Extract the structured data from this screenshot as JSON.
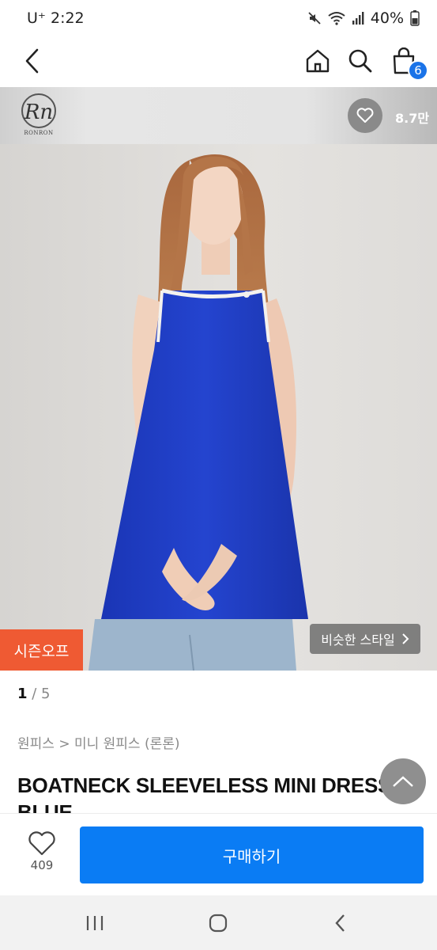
{
  "status_bar": {
    "carrier": "U⁺ 2:22",
    "battery": "40%",
    "icons": [
      "mute-icon",
      "wifi-icon",
      "signal-icon",
      "battery-icon"
    ]
  },
  "nav": {
    "icons": [
      "back-icon",
      "home-icon",
      "search-icon",
      "cart-icon"
    ],
    "cart_count": "6"
  },
  "brand": {
    "name": "RONRON",
    "monogram": "Rn",
    "like_count": "8.7만"
  },
  "photo": {
    "season_tag": "시즌오프",
    "similar_style": "비슷한 스타일"
  },
  "info": {
    "pager_current": "1",
    "pager_total": "/ 5",
    "breadcrumb": "원피스 > 미니 원피스 (론론)",
    "title": "BOATNECK SLEEVELESS MINI DRESS BLUE"
  },
  "bottom": {
    "wish_count": "409",
    "buy_label": "구매하기"
  },
  "colors": {
    "accent": "#0a7cf4",
    "season_tag": "#ef5a33",
    "dress": "#1f3cc2",
    "badge": "#1a73e8"
  }
}
